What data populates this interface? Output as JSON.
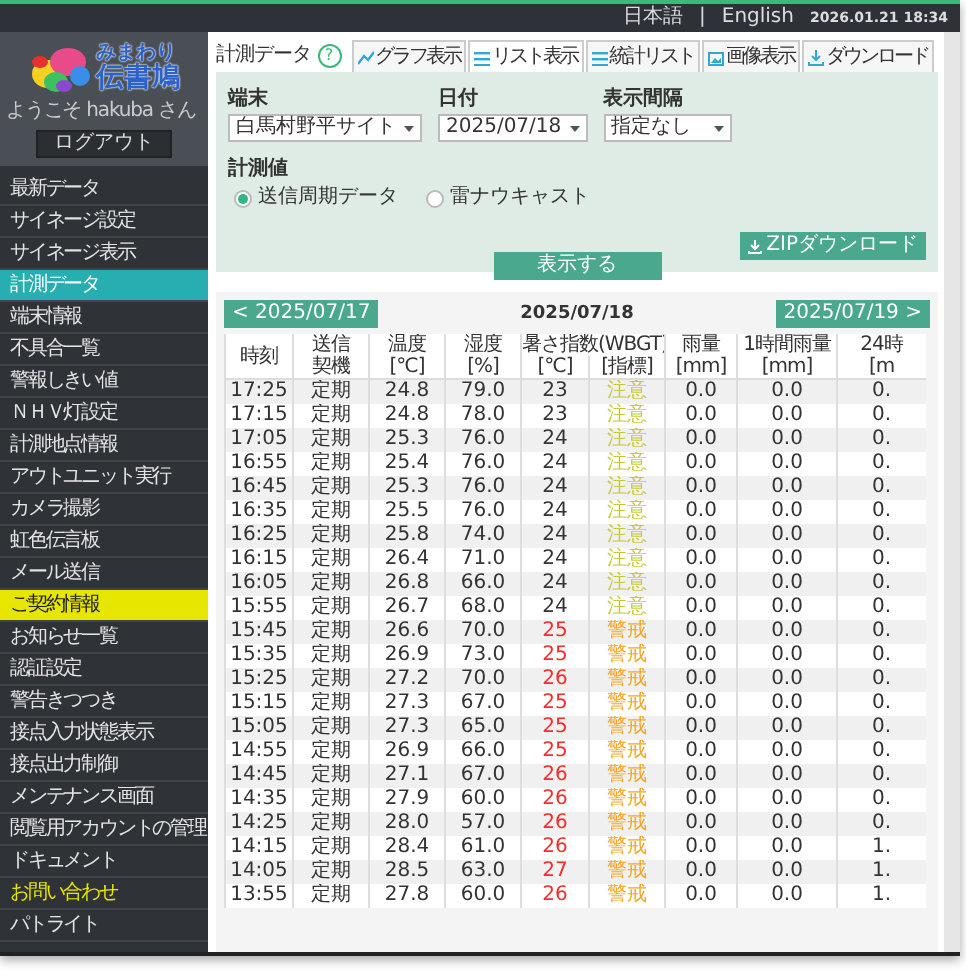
{
  "top_bar": {
    "languages": [
      "日本語",
      "English"
    ],
    "separator": "|",
    "datetime": "2026.01.21 18:34"
  },
  "sidebar": {
    "logo": {
      "line1": "みまわり",
      "line2": "伝書鳩"
    },
    "welcome": "ようこそ hakuba さん",
    "logout": "ログアウト",
    "items": [
      {
        "label": "最新データ",
        "kind": "normal",
        "selected": false
      },
      {
        "label": "サイネージ設定",
        "kind": "normal",
        "selected": false
      },
      {
        "label": "サイネージ表示",
        "kind": "normal",
        "selected": false
      },
      {
        "label": "計測データ",
        "kind": "normal",
        "selected": true
      },
      {
        "label": "端末情報",
        "kind": "normal",
        "selected": false
      },
      {
        "label": "不具合一覧",
        "kind": "normal",
        "selected": false
      },
      {
        "label": "警報しきい値",
        "kind": "normal",
        "selected": false
      },
      {
        "label": "ＮＨＶ灯設定",
        "kind": "normal",
        "selected": false
      },
      {
        "label": "計測地点情報",
        "kind": "normal",
        "selected": false
      },
      {
        "label": "アウトユニット実行",
        "kind": "normal",
        "selected": false
      },
      {
        "label": "カメラ撮影",
        "kind": "normal",
        "selected": false
      },
      {
        "label": "虹色伝言板",
        "kind": "normal",
        "selected": false
      },
      {
        "label": "メール送信",
        "kind": "normal",
        "selected": false
      },
      {
        "label": "ご契約情報",
        "kind": "notice",
        "selected": false
      },
      {
        "label": "お知らせ一覧",
        "kind": "normal",
        "selected": false
      },
      {
        "label": "認証設定",
        "kind": "normal",
        "selected": false
      },
      {
        "label": "警告きつつき",
        "kind": "normal",
        "selected": false
      },
      {
        "label": "接点入力状態表示",
        "kind": "normal",
        "selected": false
      },
      {
        "label": "接点出力制御",
        "kind": "normal",
        "selected": false
      },
      {
        "label": "メンテナンス画面",
        "kind": "normal",
        "selected": false
      },
      {
        "label": "閲覧用アカウントの管理",
        "kind": "normal",
        "selected": false
      },
      {
        "label": "ドキュメント",
        "kind": "normal",
        "selected": false
      },
      {
        "label": "お問い合わせ",
        "kind": "contact",
        "selected": false
      },
      {
        "label": "パトライト",
        "kind": "normal",
        "selected": false
      }
    ]
  },
  "content": {
    "title": "計測データ",
    "help": "?",
    "tabs": [
      {
        "label": "グラフ表示",
        "kind": "chart",
        "selected": false
      },
      {
        "label": "リスト表示",
        "kind": "list",
        "selected": true
      },
      {
        "label": "統計リスト",
        "kind": "list",
        "selected": false
      },
      {
        "label": "画像表示",
        "kind": "image",
        "selected": false
      },
      {
        "label": "ダウンロード",
        "kind": "download",
        "selected": false
      }
    ],
    "filters": {
      "terminal": {
        "label": "端末",
        "value": "白馬村野平サイト"
      },
      "date": {
        "label": "日付",
        "value": "2025/07/18"
      },
      "interval": {
        "label": "表示間隔",
        "value": "指定なし"
      },
      "measure": {
        "label": "計測値",
        "options": [
          {
            "label": "送信周期データ",
            "selected": true
          },
          {
            "label": "雷ナウキャスト",
            "selected": false
          }
        ]
      },
      "zip_button": "ZIPダウンロード",
      "show_button": "表示する"
    },
    "list": {
      "prev": "< 2025/07/17",
      "date": "2025/07/18",
      "next": "2025/07/19 >",
      "columns": [
        {
          "lines": [
            "時刻"
          ]
        },
        {
          "lines": [
            "送信",
            "契機"
          ]
        },
        {
          "lines": [
            "温度",
            "[℃]"
          ]
        },
        {
          "lines": [
            "湿度",
            "[%]"
          ]
        },
        {
          "lines": [
            "暑さ指数(WBGT)"
          ],
          "sub": [
            "[℃]",
            "[指標]"
          ]
        },
        {
          "lines": [
            "雨量",
            "[mm]"
          ]
        },
        {
          "lines": [
            "1時間雨量",
            "[mm]"
          ]
        },
        {
          "lines": [
            "24時",
            "[m"
          ]
        }
      ],
      "rows": [
        {
          "time": "17:25",
          "trigger": "定期",
          "temp": "24.8",
          "humid": "79.0",
          "wbgt": {
            "value": "23",
            "alert": false
          },
          "rank": {
            "text": "注意",
            "color": "#c8c83c"
          },
          "rain": "0.0",
          "rain_1h": "0.0",
          "rain_24h": "0."
        },
        {
          "time": "17:15",
          "trigger": "定期",
          "temp": "24.8",
          "humid": "78.0",
          "wbgt": {
            "value": "23",
            "alert": false
          },
          "rank": {
            "text": "注意",
            "color": "#c8c83c"
          },
          "rain": "0.0",
          "rain_1h": "0.0",
          "rain_24h": "0."
        },
        {
          "time": "17:05",
          "trigger": "定期",
          "temp": "25.3",
          "humid": "76.0",
          "wbgt": {
            "value": "24",
            "alert": false
          },
          "rank": {
            "text": "注意",
            "color": "#c8c83c"
          },
          "rain": "0.0",
          "rain_1h": "0.0",
          "rain_24h": "0."
        },
        {
          "time": "16:55",
          "trigger": "定期",
          "temp": "25.4",
          "humid": "76.0",
          "wbgt": {
            "value": "24",
            "alert": false
          },
          "rank": {
            "text": "注意",
            "color": "#c8c83c"
          },
          "rain": "0.0",
          "rain_1h": "0.0",
          "rain_24h": "0."
        },
        {
          "time": "16:45",
          "trigger": "定期",
          "temp": "25.3",
          "humid": "76.0",
          "wbgt": {
            "value": "24",
            "alert": false
          },
          "rank": {
            "text": "注意",
            "color": "#c8c83c"
          },
          "rain": "0.0",
          "rain_1h": "0.0",
          "rain_24h": "0."
        },
        {
          "time": "16:35",
          "trigger": "定期",
          "temp": "25.5",
          "humid": "76.0",
          "wbgt": {
            "value": "24",
            "alert": false
          },
          "rank": {
            "text": "注意",
            "color": "#c8c83c"
          },
          "rain": "0.0",
          "rain_1h": "0.0",
          "rain_24h": "0."
        },
        {
          "time": "16:25",
          "trigger": "定期",
          "temp": "25.8",
          "humid": "74.0",
          "wbgt": {
            "value": "24",
            "alert": false
          },
          "rank": {
            "text": "注意",
            "color": "#c8c83c"
          },
          "rain": "0.0",
          "rain_1h": "0.0",
          "rain_24h": "0."
        },
        {
          "time": "16:15",
          "trigger": "定期",
          "temp": "26.4",
          "humid": "71.0",
          "wbgt": {
            "value": "24",
            "alert": false
          },
          "rank": {
            "text": "注意",
            "color": "#c8c83c"
          },
          "rain": "0.0",
          "rain_1h": "0.0",
          "rain_24h": "0."
        },
        {
          "time": "16:05",
          "trigger": "定期",
          "temp": "26.8",
          "humid": "66.0",
          "wbgt": {
            "value": "24",
            "alert": false
          },
          "rank": {
            "text": "注意",
            "color": "#c8c83c"
          },
          "rain": "0.0",
          "rain_1h": "0.0",
          "rain_24h": "0."
        },
        {
          "time": "15:55",
          "trigger": "定期",
          "temp": "26.7",
          "humid": "68.0",
          "wbgt": {
            "value": "24",
            "alert": false
          },
          "rank": {
            "text": "注意",
            "color": "#c8c83c"
          },
          "rain": "0.0",
          "rain_1h": "0.0",
          "rain_24h": "0."
        },
        {
          "time": "15:45",
          "trigger": "定期",
          "temp": "26.6",
          "humid": "70.0",
          "wbgt": {
            "value": "25",
            "alert": true
          },
          "rank": {
            "text": "警戒",
            "color": "#f5a623"
          },
          "rain": "0.0",
          "rain_1h": "0.0",
          "rain_24h": "0."
        },
        {
          "time": "15:35",
          "trigger": "定期",
          "temp": "26.9",
          "humid": "73.0",
          "wbgt": {
            "value": "25",
            "alert": true
          },
          "rank": {
            "text": "警戒",
            "color": "#f5a623"
          },
          "rain": "0.0",
          "rain_1h": "0.0",
          "rain_24h": "0."
        },
        {
          "time": "15:25",
          "trigger": "定期",
          "temp": "27.2",
          "humid": "70.0",
          "wbgt": {
            "value": "26",
            "alert": true
          },
          "rank": {
            "text": "警戒",
            "color": "#f5a623"
          },
          "rain": "0.0",
          "rain_1h": "0.0",
          "rain_24h": "0."
        },
        {
          "time": "15:15",
          "trigger": "定期",
          "temp": "27.3",
          "humid": "67.0",
          "wbgt": {
            "value": "25",
            "alert": true
          },
          "rank": {
            "text": "警戒",
            "color": "#f5a623"
          },
          "rain": "0.0",
          "rain_1h": "0.0",
          "rain_24h": "0."
        },
        {
          "time": "15:05",
          "trigger": "定期",
          "temp": "27.3",
          "humid": "65.0",
          "wbgt": {
            "value": "25",
            "alert": true
          },
          "rank": {
            "text": "警戒",
            "color": "#f5a623"
          },
          "rain": "0.0",
          "rain_1h": "0.0",
          "rain_24h": "0."
        },
        {
          "time": "14:55",
          "trigger": "定期",
          "temp": "26.9",
          "humid": "66.0",
          "wbgt": {
            "value": "25",
            "alert": true
          },
          "rank": {
            "text": "警戒",
            "color": "#f5a623"
          },
          "rain": "0.0",
          "rain_1h": "0.0",
          "rain_24h": "0."
        },
        {
          "time": "14:45",
          "trigger": "定期",
          "temp": "27.1",
          "humid": "67.0",
          "wbgt": {
            "value": "26",
            "alert": true
          },
          "rank": {
            "text": "警戒",
            "color": "#f5a623"
          },
          "rain": "0.0",
          "rain_1h": "0.0",
          "rain_24h": "0."
        },
        {
          "time": "14:35",
          "trigger": "定期",
          "temp": "27.9",
          "humid": "60.0",
          "wbgt": {
            "value": "26",
            "alert": true
          },
          "rank": {
            "text": "警戒",
            "color": "#f5a623"
          },
          "rain": "0.0",
          "rain_1h": "0.0",
          "rain_24h": "0."
        },
        {
          "time": "14:25",
          "trigger": "定期",
          "temp": "28.0",
          "humid": "57.0",
          "wbgt": {
            "value": "26",
            "alert": true
          },
          "rank": {
            "text": "警戒",
            "color": "#f5a623"
          },
          "rain": "0.0",
          "rain_1h": "0.0",
          "rain_24h": "0."
        },
        {
          "time": "14:15",
          "trigger": "定期",
          "temp": "28.4",
          "humid": "61.0",
          "wbgt": {
            "value": "26",
            "alert": true
          },
          "rank": {
            "text": "警戒",
            "color": "#f5a623"
          },
          "rain": "0.0",
          "rain_1h": "0.0",
          "rain_24h": "1."
        },
        {
          "time": "14:05",
          "trigger": "定期",
          "temp": "28.5",
          "humid": "63.0",
          "wbgt": {
            "value": "27",
            "alert": true
          },
          "rank": {
            "text": "警戒",
            "color": "#f5a623"
          },
          "rain": "0.0",
          "rain_1h": "0.0",
          "rain_24h": "1."
        },
        {
          "time": "13:55",
          "trigger": "定期",
          "temp": "27.8",
          "humid": "60.0",
          "wbgt": {
            "value": "26",
            "alert": true
          },
          "rank": {
            "text": "警戒",
            "color": "#f5a623"
          },
          "rain": "0.0",
          "rain_1h": "0.0",
          "rain_24h": "1."
        }
      ]
    }
  }
}
